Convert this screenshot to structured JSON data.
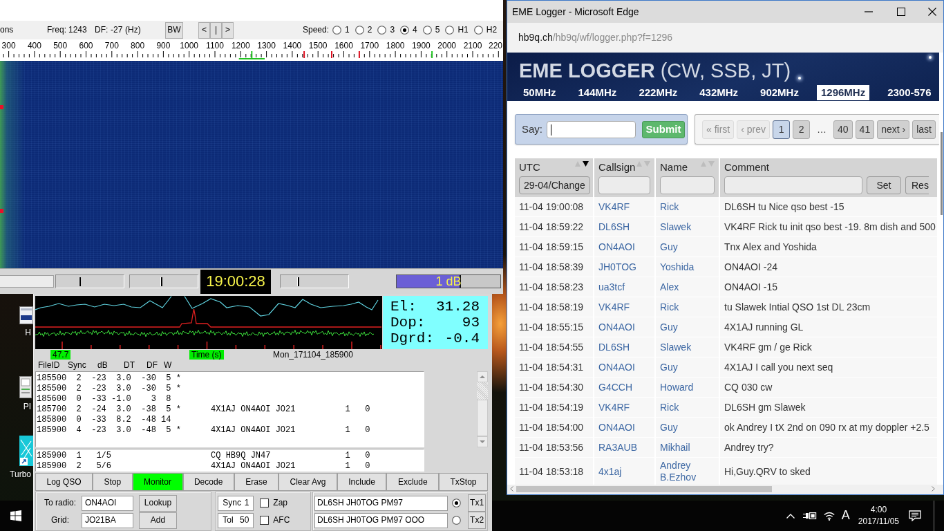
{
  "waterfall_window": {
    "toolbar": {
      "menu": "ons",
      "freq_label": "Freq:",
      "freq": "1243",
      "df_label": "DF:",
      "df": "-27",
      "df_unit": "(Hz)",
      "bw_button": "BW",
      "nav_buttons": [
        "<",
        "|",
        ">"
      ],
      "speed_label": "Speed:",
      "speeds": [
        {
          "label": "1",
          "selected": false
        },
        {
          "label": "2",
          "selected": false
        },
        {
          "label": "3",
          "selected": false
        },
        {
          "label": "4",
          "selected": true
        },
        {
          "label": "5",
          "selected": false
        },
        {
          "label": "H1",
          "selected": false
        },
        {
          "label": "H2",
          "selected": false
        }
      ]
    },
    "scale_labels": [
      "300",
      "400",
      "500",
      "600",
      "700",
      "800",
      "900",
      "1000",
      "1100",
      "1200",
      "1300",
      "1400",
      "1500",
      "1600",
      "1700",
      "1800",
      "1900",
      "2000",
      "2100",
      "220"
    ],
    "controls": [
      {
        "kind": "field"
      },
      {
        "kind": "slider",
        "level": 0.35
      },
      {
        "kind": "slider",
        "level": 0.46
      },
      {
        "kind": "clock",
        "text": "19:00:28"
      },
      {
        "kind": "slider",
        "level": 0.25
      },
      {
        "kind": "meter",
        "level": 0.62,
        "reading": "1 dB"
      }
    ]
  },
  "decoder_window": {
    "moon_data": [
      {
        "label": "El:",
        "value": "31.28"
      },
      {
        "label": "Dop:",
        "value": "93"
      },
      {
        "label": "Dgrd:",
        "value": "-0.4"
      }
    ],
    "plot_labels": [
      {
        "text": "47.7",
        "kind": "highlight"
      },
      {
        "text": "Time (s)",
        "kind": "highlight"
      },
      {
        "text": "Mon_171104_185900",
        "kind": "plain"
      }
    ],
    "decode_columns": [
      "FileID",
      "Sync",
      "dB",
      "DT",
      "DF",
      "W"
    ],
    "decode_lines": [
      "185500  2  -23  3.0  -30  5 *",
      "185500  2  -23  3.0  -30  5 *",
      "185600  0  -33 -1.0    3  8",
      "185700  2  -24  3.0  -38  5 *      4X1AJ ON4AOI JO21          1   0",
      "185800  0  -33  8.2  -48 14",
      "185900  4  -23  3.0  -48  5 *      4X1AJ ON4AOI JO21          1   0"
    ],
    "average_lines": [
      "185900  1   1/5                    CQ HB9Q JN47               1   0",
      "185900  2   5/6                    4X1AJ ON4AOI JO21          1   0"
    ],
    "buttons": [
      {
        "label": "Log QSO",
        "on": false
      },
      {
        "label": "Stop",
        "on": false
      },
      {
        "label": "Monitor",
        "on": true
      },
      {
        "label": "Decode",
        "on": false
      },
      {
        "label": "Erase",
        "on": false
      },
      {
        "label": "Clear Avg",
        "on": false
      },
      {
        "label": "Include",
        "on": false
      },
      {
        "label": "Exclude",
        "on": false
      },
      {
        "label": "TxStop",
        "on": false
      }
    ],
    "station": [
      {
        "label": "To radio:",
        "value": "ON4AOI",
        "button": "Lookup"
      },
      {
        "label": "Grid:",
        "value": "JO21BA",
        "button": "Add"
      }
    ],
    "options": [
      {
        "label": "Sync",
        "value": "1",
        "check_label": "Zap",
        "checked": false
      },
      {
        "label": "Tol",
        "value": "50",
        "check_label": "AFC",
        "checked": false
      }
    ],
    "tx_messages": [
      {
        "text": "DL6SH JH0TOG PM97",
        "selected": true,
        "button": "Tx1"
      },
      {
        "text": "DL6SH JH0TOG PM97 OOO",
        "selected": false,
        "button": "Tx2"
      }
    ]
  },
  "desktop_icons": [
    {
      "label": "H",
      "kind": "window"
    },
    {
      "label": "PI",
      "kind": "device"
    },
    {
      "label": "Turbo",
      "kind": "shortcut"
    }
  ],
  "browser": {
    "title": "EME Logger - Microsoft Edge",
    "url": "hb9q.ch/hb9q/wf/logger.php?f=1296",
    "heading": "**EME LOGGER** (CW, SSB, JT)",
    "bands": [
      {
        "label": "50MHz",
        "selected": false
      },
      {
        "label": "144MHz",
        "selected": false
      },
      {
        "label": "222MHz",
        "selected": false
      },
      {
        "label": "432MHz",
        "selected": false
      },
      {
        "label": "902MHz",
        "selected": false
      },
      {
        "label": "1296MHz",
        "selected": true
      },
      {
        "label": "2300-576",
        "selected": false
      }
    ],
    "say": {
      "label": "Say:",
      "focused": true,
      "button": "Submit"
    },
    "pagination": [
      {
        "kind": "button",
        "label": "« first",
        "disabled": true,
        "selected": false
      },
      {
        "kind": "button",
        "label": "‹ prev",
        "disabled": true,
        "selected": false
      },
      {
        "kind": "button",
        "label": "1",
        "disabled": false,
        "selected": true
      },
      {
        "kind": "button",
        "label": "2",
        "disabled": false,
        "selected": false
      },
      {
        "kind": "gap",
        "label": "…"
      },
      {
        "kind": "button",
        "label": "40",
        "disabled": false,
        "selected": false
      },
      {
        "kind": "button",
        "label": "41",
        "disabled": false,
        "selected": false
      },
      {
        "kind": "button",
        "label": "next ›",
        "disabled": false,
        "selected": false
      },
      {
        "kind": "button",
        "label": "last",
        "disabled": false,
        "selected": false
      }
    ],
    "table": {
      "columns": [
        {
          "label": "UTC",
          "sortable": true,
          "sorted_descending": true
        },
        {
          "label": "Callsign",
          "sortable": true,
          "sorted_descending": false
        },
        {
          "label": "Name",
          "sortable": true,
          "sorted_descending": false
        },
        {
          "label": "Comment",
          "sortable": false
        }
      ],
      "filters": [
        [
          {
            "kind": "button",
            "label": "29-04/Change"
          }
        ],
        [
          {
            "kind": "input"
          }
        ],
        [
          {
            "kind": "input"
          }
        ],
        [
          {
            "kind": "input"
          },
          {
            "kind": "button",
            "label": "Set"
          },
          {
            "kind": "button",
            "label": "Res"
          }
        ]
      ],
      "rows": [
        {
          "utc": "11-04 19:00:08",
          "callsign": "VK4RF",
          "name": "Rick",
          "comment": "DL6SH tu Nice qso best -15"
        },
        {
          "utc": "11-04 18:59:22",
          "callsign": "DL6SH",
          "name": "Slawek",
          "comment": "VK4RF Rick tu init qso best -19. 8m dish and 500"
        },
        {
          "utc": "11-04 18:59:15",
          "callsign": "ON4AOI",
          "name": "Guy",
          "comment": "Tnx Alex and Yoshida"
        },
        {
          "utc": "11-04 18:58:39",
          "callsign": "JH0TOG",
          "name": "Yoshida",
          "comment": "ON4AOI -24"
        },
        {
          "utc": "11-04 18:58:23",
          "callsign": "ua3tcf",
          "name": "Alex",
          "comment": "ON4AOI -15"
        },
        {
          "utc": "11-04 18:58:19",
          "callsign": "VK4RF",
          "name": "Rick",
          "comment": "tu Slawek Intial QSO 1st DL 23cm"
        },
        {
          "utc": "11-04 18:55:15",
          "callsign": "ON4AOI",
          "name": "Guy",
          "comment": "4X1AJ running GL"
        },
        {
          "utc": "11-04 18:54:55",
          "callsign": "DL6SH",
          "name": "Slawek",
          "comment": "VK4RF gm / ge Rick"
        },
        {
          "utc": "11-04 18:54:31",
          "callsign": "ON4AOI",
          "name": "Guy",
          "comment": "4X1AJ I call you next seq"
        },
        {
          "utc": "11-04 18:54:30",
          "callsign": "G4CCH",
          "name": "Howard",
          "comment": "CQ 030 cw"
        },
        {
          "utc": "11-04 18:54:19",
          "callsign": "VK4RF",
          "name": "Rick",
          "comment": "DL6SH gm Slawek"
        },
        {
          "utc": "11-04 18:54:00",
          "callsign": "ON4AOI",
          "name": "Guy",
          "comment": "ok Andrey I tX 2nd on 090 rx at my doppler +2.5"
        },
        {
          "utc": "11-04 18:53:56",
          "callsign": "RA3AUB",
          "name": "Mikhail",
          "comment": "Andrey try?"
        },
        {
          "utc": "11-04 18:53:18",
          "callsign": "4x1aj",
          "name": "Andrey B.Ezhov",
          "comment": "Hi,Guy.QRV to sked"
        }
      ]
    }
  },
  "taskbar": {
    "ime": "A",
    "time": "4:00",
    "date": "2017/11/05"
  }
}
